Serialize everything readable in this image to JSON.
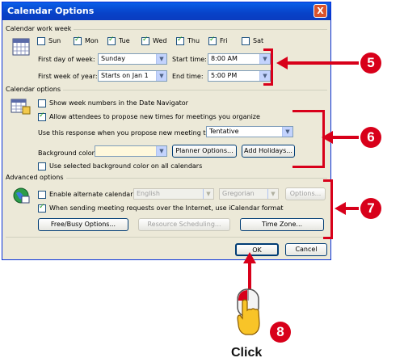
{
  "dialog": {
    "title": "Calendar Options",
    "close_glyph": "X"
  },
  "work_week": {
    "section_label": "Calendar work week",
    "days": [
      {
        "label": "Sun",
        "checked": false
      },
      {
        "label": "Mon",
        "checked": true
      },
      {
        "label": "Tue",
        "checked": true
      },
      {
        "label": "Wed",
        "checked": true
      },
      {
        "label": "Thu",
        "checked": true
      },
      {
        "label": "Fri",
        "checked": true
      },
      {
        "label": "Sat",
        "checked": false
      }
    ],
    "first_day_label": "First day of week:",
    "first_day_value": "Sunday",
    "first_week_label": "First week of year:",
    "first_week_value": "Starts on Jan 1",
    "start_time_label": "Start time:",
    "start_time_value": "8:00 AM",
    "end_time_label": "End time:",
    "end_time_value": "5:00 PM"
  },
  "cal_options": {
    "section_label": "Calendar options",
    "show_week_numbers": "Show week numbers in the Date Navigator",
    "allow_attendees": "Allow attendees to propose new times for meetings you organize",
    "use_response_label": "Use this response when you propose new meeting times:",
    "use_response_value": "Tentative",
    "background_color_label": "Background color:",
    "planner_options": "Planner Options...",
    "add_holidays": "Add Holidays...",
    "use_selected_bg": "Use selected background color on all calendars"
  },
  "advanced": {
    "section_label": "Advanced options",
    "enable_alt_calendar": "Enable alternate calendar:",
    "alt_language": "English",
    "alt_type": "Gregorian",
    "options_btn": "Options...",
    "icalendar": "When sending meeting requests over the Internet, use iCalendar format",
    "freebusy": "Free/Busy Options...",
    "resource_scheduling": "Resource Scheduling...",
    "time_zone": "Time Zone..."
  },
  "footer": {
    "ok": "OK",
    "cancel": "Cancel"
  },
  "callouts": {
    "five": "5",
    "six": "6",
    "seven": "7",
    "eight": "8",
    "click": "Click"
  },
  "colors": {
    "accent_red": "#d8001a",
    "titlebar_blue": "#0842c8",
    "dialog_bg": "#ece9d8"
  },
  "icons": [
    "calendar-grid-icon",
    "calendar-options-icon",
    "globe-calendar-icon",
    "mouse-hand-icon"
  ]
}
